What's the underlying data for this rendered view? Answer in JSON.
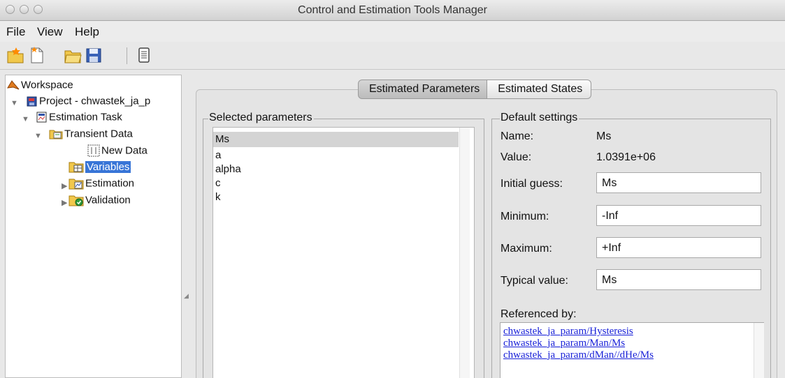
{
  "window": {
    "title": "Control and Estimation Tools Manager"
  },
  "menubar": {
    "items": [
      "File",
      "View",
      "Help"
    ]
  },
  "toolbar": {
    "buttons": [
      "new-project-icon",
      "new-task-icon",
      "open-icon",
      "save-icon",
      "properties-icon"
    ]
  },
  "tree": {
    "items": [
      {
        "label": "Workspace",
        "icon": "matlab-workspace-icon"
      },
      {
        "label": "Project - chwastek_ja_p",
        "icon": "project-icon"
      },
      {
        "label": "Estimation Task",
        "icon": "estimation-task-icon"
      },
      {
        "label": "Transient Data",
        "icon": "transient-data-folder-icon"
      },
      {
        "label": "New Data",
        "icon": "data-grid-icon"
      },
      {
        "label": "Variables",
        "icon": "variables-folder-icon"
      },
      {
        "label": "Estimation",
        "icon": "estimation-folder-icon"
      },
      {
        "label": "Validation",
        "icon": "validation-folder-icon"
      }
    ]
  },
  "tabs": [
    {
      "label": "Estimated Parameters"
    },
    {
      "label": "Estimated States"
    }
  ],
  "selected_parameters": {
    "title": "Selected parameters",
    "items": [
      "Ms",
      "a",
      "alpha",
      "c",
      "k"
    ]
  },
  "default_settings": {
    "title": "Default settings",
    "name_label": "Name:",
    "name_value": "Ms",
    "value_label": "Value:",
    "value_value": "1.0391e+06",
    "initial_guess_label": "Initial guess:",
    "initial_guess_value": "Ms",
    "minimum_label": "Minimum:",
    "minimum_value": "-Inf",
    "maximum_label": "Maximum:",
    "maximum_value": "+Inf",
    "typical_value_label": "Typical value:",
    "typical_value_value": "Ms",
    "referenced_by_label": "Referenced by:",
    "referenced_by": [
      "chwastek_ja_param/Hysteresis",
      "chwastek_ja_param/Man/Ms",
      "chwastek_ja_param/dMan//dHe/Ms"
    ]
  },
  "colors": {
    "selection": "#3875d7",
    "link": "#1a22d8"
  }
}
